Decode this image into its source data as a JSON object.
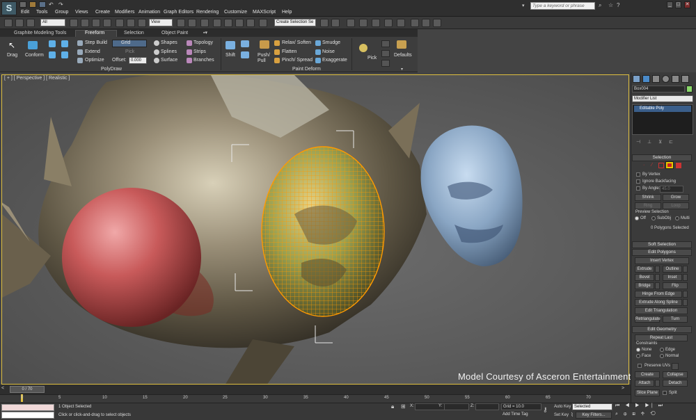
{
  "menu": {
    "items": [
      "Edit",
      "Tools",
      "Group",
      "Views",
      "Create",
      "Modifiers",
      "Animation",
      "Graph Editors",
      "Rendering",
      "Customize",
      "MAXScript",
      "Help"
    ],
    "search_placeholder": "Type a keyword or phrase"
  },
  "toolbar": {
    "selection_filter": "All",
    "ref_coord": "View",
    "named_selection": "Create Selection Se"
  },
  "ribbon": {
    "tabs": [
      "Graphite Modeling Tools",
      "Freeform",
      "Selection",
      "Object Paint"
    ],
    "active_tab": "Freeform",
    "polydraw": {
      "drag": "Drag",
      "conform": "Conform",
      "step_build": "Step Build",
      "extend": "Extend",
      "optimize": "Optimize",
      "grid": "Grid",
      "pick": "Pick",
      "offset_label": "Offset:",
      "offset_value": "0.000",
      "shapes": "Shapes",
      "splines": "Splines",
      "surface": "Surface",
      "topology": "Topology",
      "strips": "Strips",
      "branches": "Branches",
      "panel_title": "PolyDraw"
    },
    "paint_deform": {
      "shift": "Shift",
      "push_pull": "Push/\nPull",
      "relax_soften": "Relax/ Soften",
      "flatten": "Flatten",
      "pinch_spread": "Pinch/ Spread",
      "smudge": "Smudge",
      "noise": "Noise",
      "exaggerate": "Exaggerate",
      "pick": "Pick",
      "defaults": "Defaults",
      "panel_title": "Paint Deform"
    }
  },
  "viewport": {
    "label": "[ + ] [ Perspective ] [ Realistic ]",
    "credit": "Model Courtesy of Asceron Entertainment"
  },
  "command_panel": {
    "object_name": "Box004",
    "modifier_list": "Modifier List",
    "stack": [
      "Editable Poly"
    ],
    "selection": {
      "title": "Selection",
      "by_vertex": "By Vertex",
      "ignore_backfacing": "Ignore Backfacing",
      "by_angle": "By Angle:",
      "angle_value": "45.0",
      "shrink": "Shrink",
      "grow": "Grow",
      "ring": "Ring",
      "loop": "Loop",
      "preview_selection": "Preview Selection",
      "preview_options": [
        "Off",
        "SubObj",
        "Multi"
      ],
      "status": "0 Polygons Selected"
    },
    "soft_selection": "Soft Selection",
    "edit_polygons": {
      "title": "Edit Polygons",
      "insert_vertex": "Insert Vertex",
      "extrude": "Extrude",
      "outline": "Outline",
      "bevel": "Bevel",
      "inset": "Inset",
      "bridge": "Bridge",
      "flip": "Flip",
      "hinge_from_edge": "Hinge From Edge",
      "extrude_along_spline": "Extrude Along Spline",
      "edit_triangulation": "Edit Triangulation",
      "retriangulate": "Retriangulate",
      "turn": "Turn"
    },
    "edit_geometry": {
      "title": "Edit Geometry",
      "repeat_last": "Repeat Last",
      "constraints": "Constraints",
      "constraint_options": [
        "None",
        "Edge",
        "Face",
        "Normal"
      ],
      "preserve_uvs": "Preserve UVs",
      "create": "Create",
      "collapse": "Collapse",
      "attach": "Attach",
      "detach": "Detach",
      "slice_plane": "Slice Plane",
      "split": "Split"
    }
  },
  "timeline": {
    "frame_counter": "0 / 70",
    "ticks": [
      "0",
      "5",
      "10",
      "15",
      "20",
      "25",
      "30",
      "35",
      "40",
      "45",
      "50",
      "55",
      "60",
      "65",
      "70"
    ]
  },
  "status": {
    "selected": "1 Object Selected",
    "prompt": "Click or click-and-drag to select objects",
    "x_label": "X:",
    "y_label": "Y:",
    "z_label": "Z:",
    "grid": "Grid = 10.0",
    "add_time_tag": "Add Time Tag",
    "auto_key": "Auto Key",
    "set_key": "Set Key",
    "key_mode": "Selected",
    "key_filters": "Key Filters..."
  },
  "colors": {
    "accent_highlight": "#e0c040",
    "selection_orange": "#ff9a00"
  }
}
